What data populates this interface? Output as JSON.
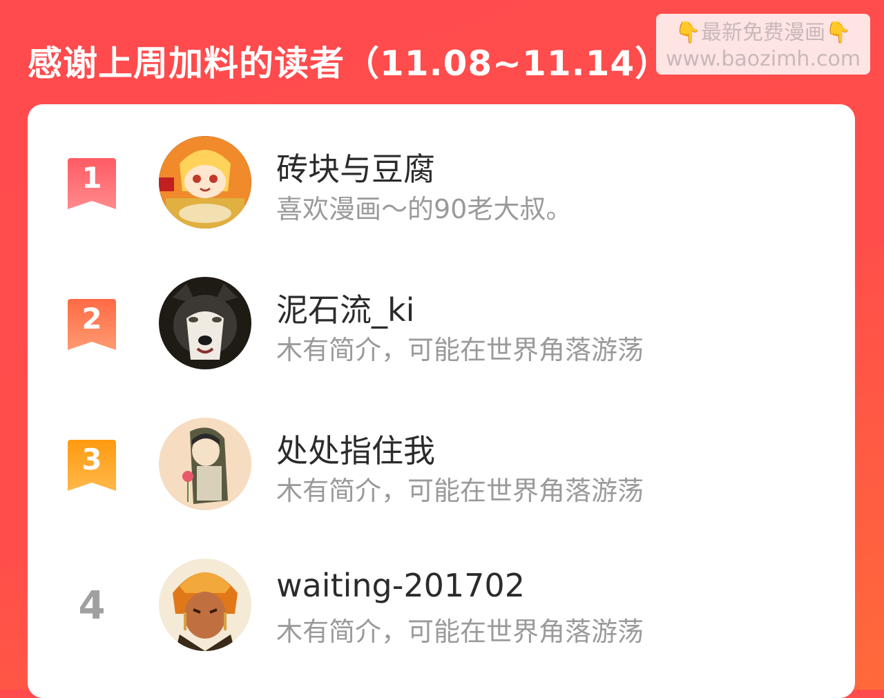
{
  "header": {
    "title": "感谢上周加料的读者（11.08~11.14）"
  },
  "watermark": {
    "line1_icon_left": "👇",
    "line1_text": "最新免费漫画",
    "line1_icon_right": "👇",
    "line2": "www.baozimh.com"
  },
  "colors": {
    "background": "#ff4a4e",
    "rank1": "#ff6b6e",
    "rank2": "#ff7a55",
    "rank3": "#ffa020",
    "rank_plain": "#a0a0a0"
  },
  "readers": [
    {
      "rank": "1",
      "name": "砖块与豆腐",
      "bio": "喜欢漫画～的90老大叔。",
      "avatar_icon": "anime-girl-avatar"
    },
    {
      "rank": "2",
      "name": "泥石流_ki",
      "bio": "木有简介，可能在世界角落游荡",
      "avatar_icon": "husky-dog-avatar"
    },
    {
      "rank": "3",
      "name": "处处指住我",
      "bio": "木有简介，可能在世界角落游荡",
      "avatar_icon": "hooded-boy-avatar"
    },
    {
      "rank": "4",
      "name": "waiting-201702",
      "bio": "木有简介，可能在世界角落游荡",
      "avatar_icon": "fire-character-avatar"
    }
  ]
}
